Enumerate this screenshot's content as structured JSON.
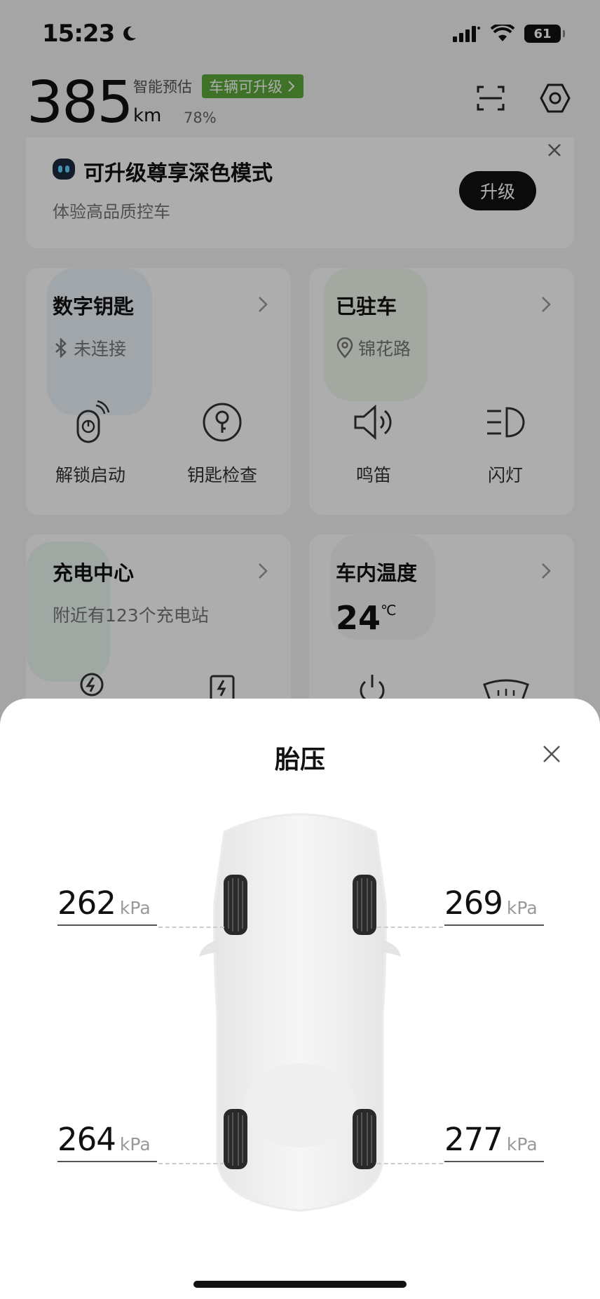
{
  "status_bar": {
    "time": "15:23",
    "battery": "61"
  },
  "header": {
    "range_value": "385",
    "range_unit": "km",
    "range_estimate_label": "智能预估",
    "upgrade_tag": "车辆可升级",
    "battery_percent": "78%"
  },
  "banner": {
    "title": "可升级尊享深色模式",
    "subtitle": "体验高品质控车",
    "button": "升级"
  },
  "cards": {
    "digital_key": {
      "title": "数字钥匙",
      "status": "未连接",
      "actions": [
        "解锁启动",
        "钥匙检查"
      ]
    },
    "parked": {
      "title": "已驻车",
      "location": "锦花路",
      "actions": [
        "鸣笛",
        "闪灯"
      ]
    },
    "charging": {
      "title": "充电中心",
      "subtitle": "附近有123个充电站"
    },
    "cabin_temp": {
      "title": "车内温度",
      "value": "24",
      "unit": "℃"
    }
  },
  "sheet": {
    "title": "胎压",
    "unit": "kPa",
    "tires": {
      "front_left": "262",
      "front_right": "269",
      "rear_left": "264",
      "rear_right": "277"
    }
  }
}
